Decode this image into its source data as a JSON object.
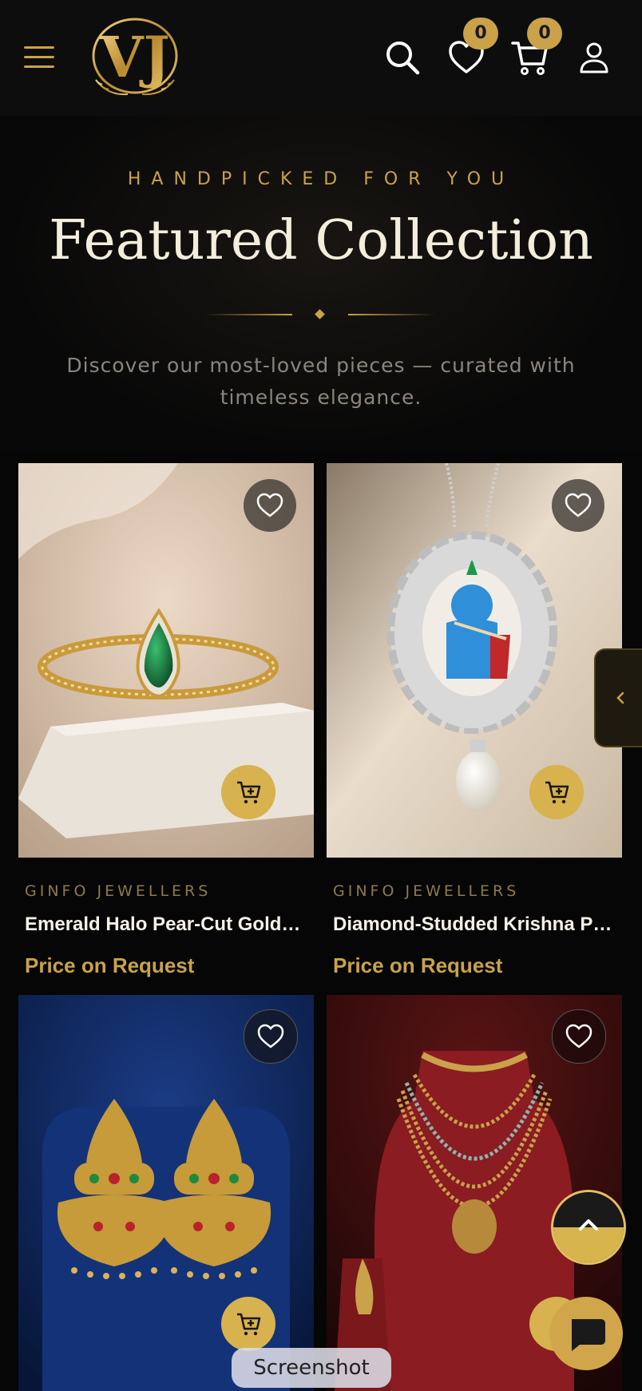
{
  "header": {
    "menu_icon": "hamburger-icon",
    "logo_text": "VJ",
    "search_icon": "search-icon",
    "wishlist_count": "0",
    "cart_count": "0",
    "account_icon": "user-icon"
  },
  "section": {
    "eyebrow": "HANDPICKED FOR YOU",
    "title": "Featured Collection",
    "subtitle": "Discover our most-loved pieces — curated with timeless elegance."
  },
  "products": [
    {
      "brand": "GINFO JEWELLERS",
      "name": "Emerald Halo Pear-Cut Gold Ring",
      "price": "Price on Request"
    },
    {
      "brand": "GINFO JEWELLERS",
      "name": "Diamond-Studded Krishna Pendant",
      "price": "Price on Request"
    },
    {
      "brand": "",
      "name": "",
      "price": ""
    },
    {
      "brand": "",
      "name": "",
      "price": ""
    }
  ],
  "overlay": {
    "screenshot_label": "Screenshot"
  },
  "colors": {
    "accent_gold": "#c9a24a",
    "background": "#060606",
    "title_cream": "#f3eddc"
  }
}
